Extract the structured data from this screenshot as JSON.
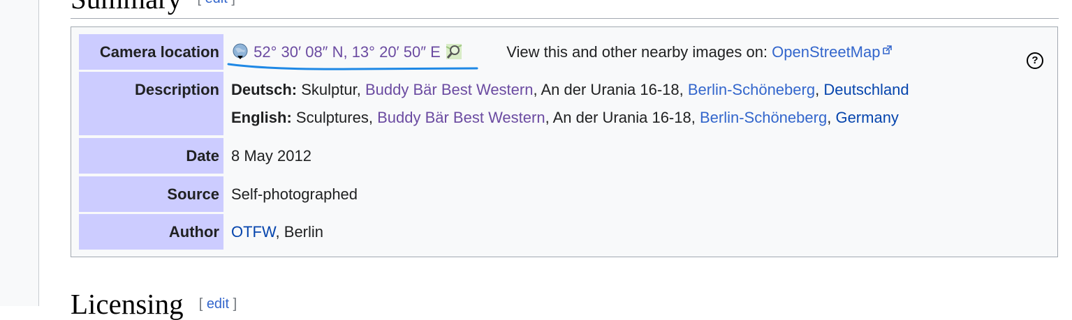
{
  "summary_section": {
    "title": "Summary",
    "edit_label": "edit"
  },
  "licensing_section": {
    "title": "Licensing",
    "edit_label": "edit"
  },
  "camera_location": {
    "label": "Camera location",
    "coordinates": "52° 30′ 08″ N, 13° 20′ 50″ E",
    "nearby_text": "View this and other nearby images on:",
    "nearby_link": "OpenStreetMap",
    "help_symbol": "?"
  },
  "description": {
    "label": "Description",
    "de_lang": "Deutsch:",
    "de_text1": "Skulptur,",
    "de_link1": "Buddy Bär Best Western",
    "de_text2": ", An der Urania 16-18,",
    "de_link2": "Berlin-Schöneberg",
    "de_sep": ",",
    "de_link3": "Deutschland",
    "en_lang": "English:",
    "en_text1": "Sculptures,",
    "en_link1": "Buddy Bär Best Western",
    "en_text2": ", An der Urania 16-18,",
    "en_link2": "Berlin-Schöneberg",
    "en_sep": ",",
    "en_link3": "Germany"
  },
  "date": {
    "label": "Date",
    "value": "8 May 2012"
  },
  "source": {
    "label": "Source",
    "value": "Self-photographed"
  },
  "author": {
    "label": "Author",
    "link": "OTFW",
    "rest": ", Berlin"
  },
  "colors": {
    "label_bg": "#ccccff",
    "link": "#3366cc",
    "visited": "#6b4ba1",
    "annotation": "#1e88e5"
  }
}
